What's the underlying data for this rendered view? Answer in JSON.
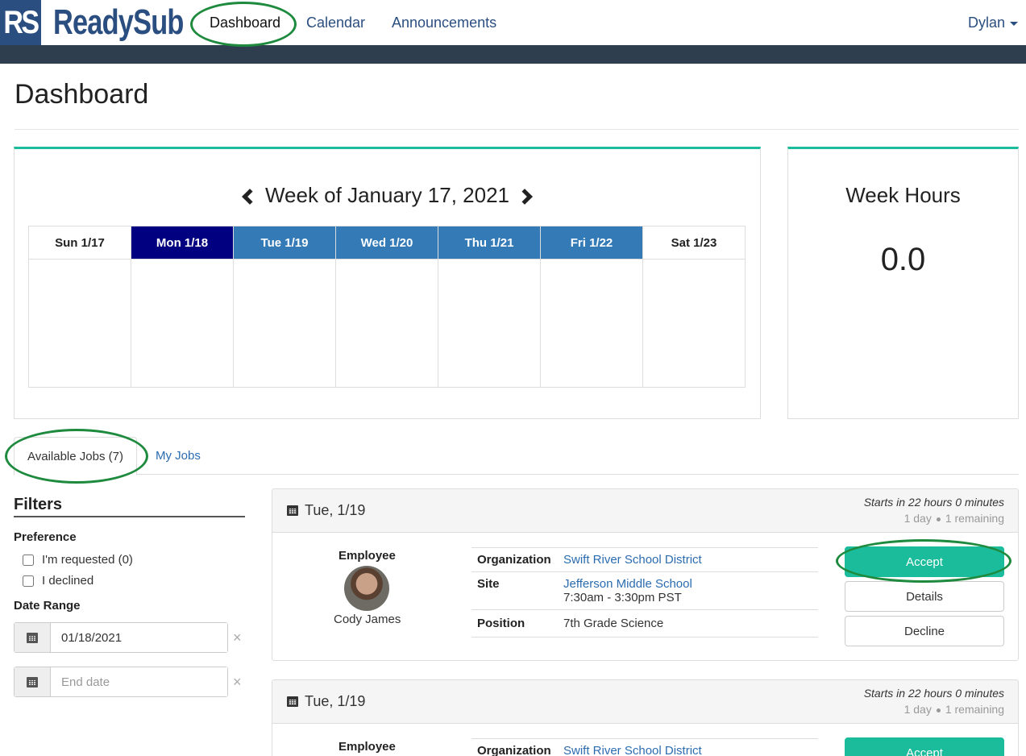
{
  "nav": {
    "logo_mark": "RS",
    "logo_text": "ReadySub",
    "links": [
      "Dashboard",
      "Calendar",
      "Announcements"
    ],
    "user": "Dylan"
  },
  "page": {
    "title": "Dashboard"
  },
  "calendar": {
    "week_label": "Week of January 17, 2021",
    "days": [
      "Sun 1/17",
      "Mon 1/18",
      "Tue 1/19",
      "Wed 1/20",
      "Thu 1/21",
      "Fri 1/22",
      "Sat 1/23"
    ]
  },
  "hours": {
    "title": "Week Hours",
    "value": "0.0"
  },
  "tabs": {
    "available": "Available Jobs (7)",
    "mine": "My Jobs"
  },
  "filters": {
    "title": "Filters",
    "preference_label": "Preference",
    "requested": "I'm requested (0)",
    "declined": "I declined",
    "date_range_label": "Date Range",
    "start_value": "01/18/2021",
    "end_placeholder": "End date",
    "clear": "×"
  },
  "jobs": [
    {
      "date": "Tue, 1/19",
      "starts": "Starts in 22 hours 0 minutes",
      "duration": "1 day",
      "remaining": "1 remaining",
      "employee_label": "Employee",
      "employee_name": "Cody James",
      "org_label": "Organization",
      "org": "Swift River School District",
      "site_label": "Site",
      "site": "Jefferson Middle School",
      "time": "7:30am - 3:30pm PST",
      "position_label": "Position",
      "position": "7th Grade Science",
      "accept": "Accept",
      "details": "Details",
      "decline": "Decline"
    },
    {
      "date": "Tue, 1/19",
      "starts": "Starts in 22 hours 0 minutes",
      "duration": "1 day",
      "remaining": "1 remaining",
      "employee_label": "Employee",
      "org_label": "Organization",
      "org": "Swift River School District",
      "accept": "Accept"
    }
  ]
}
